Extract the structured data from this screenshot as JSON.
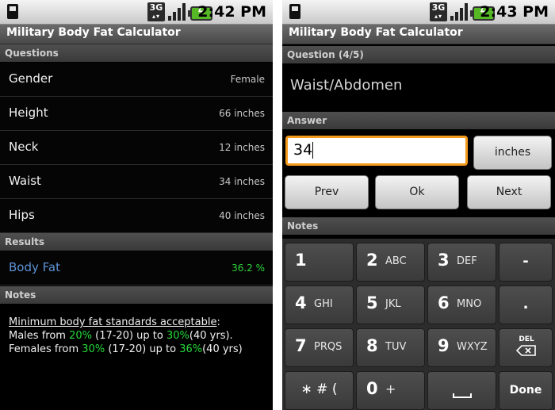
{
  "left": {
    "status": {
      "time": "2:42 PM",
      "network": "3G"
    },
    "title": "Military Body Fat Calculator",
    "questions_header": "Questions",
    "questions": [
      {
        "label": "Gender",
        "value": "Female"
      },
      {
        "label": "Height",
        "value": "66 inches"
      },
      {
        "label": "Neck",
        "value": "12 inches"
      },
      {
        "label": "Waist",
        "value": "34 inches"
      },
      {
        "label": "Hips",
        "value": "40 inches"
      }
    ],
    "results_header": "Results",
    "result": {
      "label": "Body Fat",
      "value": "36.2 %"
    },
    "notes_header": "Notes",
    "notes": {
      "heading": "Minimum body fat standards acceptable",
      "colon": ":",
      "males_prefix": "Males from ",
      "males_low": "20%",
      "males_mid": " (17-20) up to ",
      "males_high": "30%",
      "males_suffix": "(40 yrs).",
      "females_prefix": "Females from ",
      "females_low": "30%",
      "females_mid": " (17-20) up to ",
      "females_high": "36%",
      "females_suffix": "(40 yrs)"
    }
  },
  "right": {
    "status": {
      "time": "2:43 PM",
      "network": "3G"
    },
    "title": "Military Body Fat Calculator",
    "question_header": "Question (4/5)",
    "question_text": "Waist/Abdomen",
    "answer_header": "Answer",
    "answer_value": "34",
    "unit_button": "inches",
    "prev_button": "Prev",
    "ok_button": "Ok",
    "next_button": "Next",
    "notes_header": "Notes",
    "keypad": {
      "k1": {
        "num": "1",
        "sub": ""
      },
      "k2": {
        "num": "2",
        "sub": "ABC"
      },
      "k3": {
        "num": "3",
        "sub": "DEF"
      },
      "k4": {
        "num": "4",
        "sub": "GHI"
      },
      "k5": {
        "num": "5",
        "sub": "JKL"
      },
      "k6": {
        "num": "6",
        "sub": "MNO"
      },
      "k7": {
        "num": "7",
        "sub": "PRQS"
      },
      "k8": {
        "num": "8",
        "sub": "TUV"
      },
      "k9": {
        "num": "9",
        "sub": "WXYZ"
      },
      "k0": {
        "num": "0",
        "sub": "+"
      },
      "minus": "-",
      "dot": ".",
      "del": "DEL",
      "symbols": "∗ # (",
      "done": "Done"
    }
  }
}
